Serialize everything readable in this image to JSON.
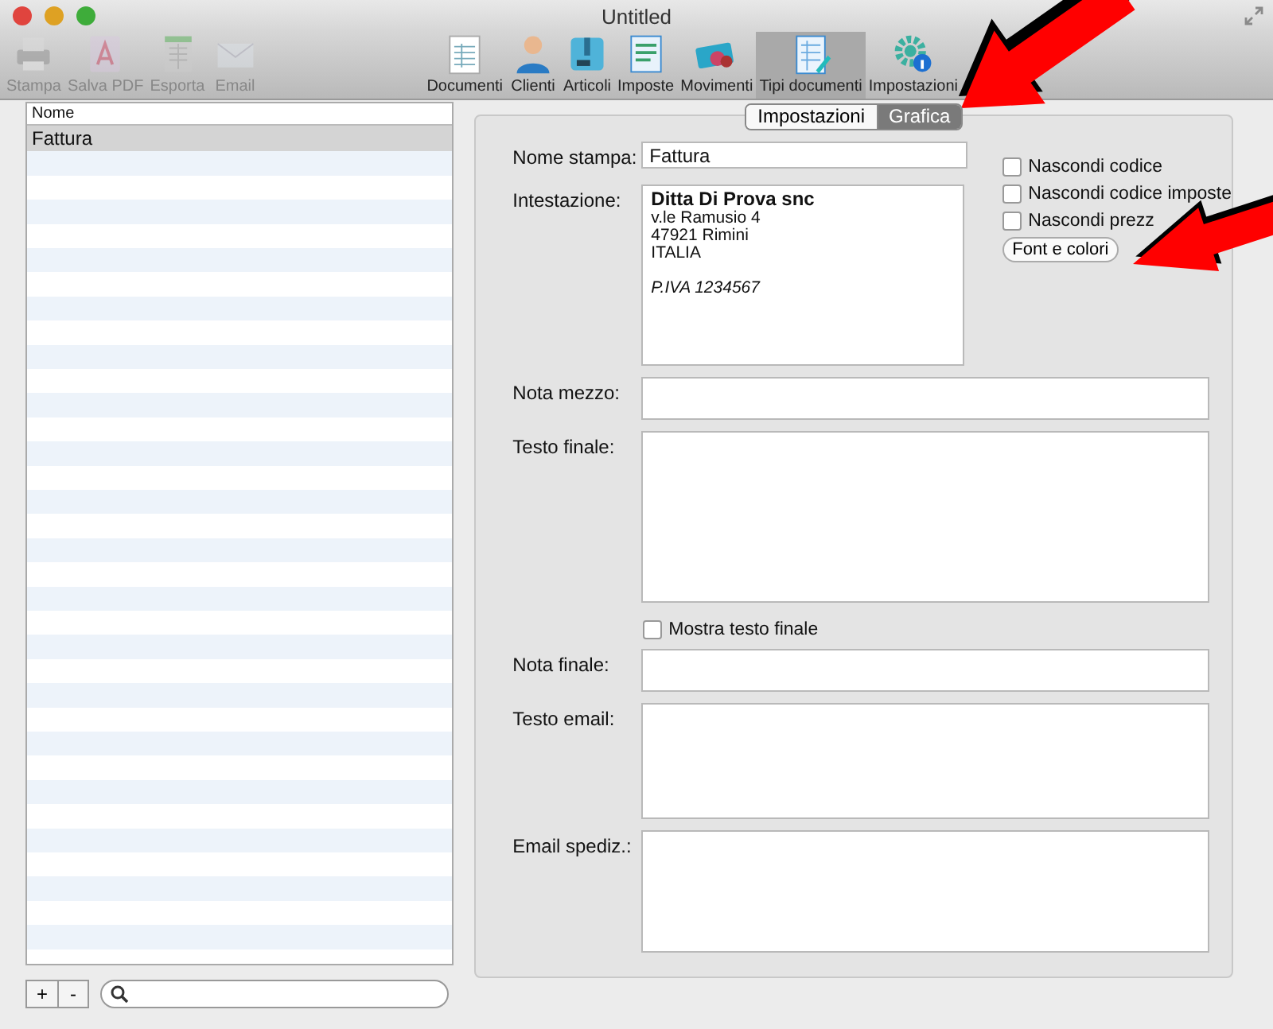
{
  "window": {
    "title": "Untitled"
  },
  "toolbar": [
    {
      "label": "Stampa",
      "disabled": true,
      "selected": false
    },
    {
      "label": "Salva PDF",
      "disabled": true,
      "selected": false
    },
    {
      "label": "Esporta",
      "disabled": true,
      "selected": false
    },
    {
      "label": "Email",
      "disabled": true,
      "selected": false
    },
    {
      "label": "Documenti",
      "disabled": false,
      "selected": false
    },
    {
      "label": "Clienti",
      "disabled": false,
      "selected": false
    },
    {
      "label": "Articoli",
      "disabled": false,
      "selected": false
    },
    {
      "label": "Imposte",
      "disabled": false,
      "selected": false
    },
    {
      "label": "Movimenti",
      "disabled": false,
      "selected": false
    },
    {
      "label": "Tipi documenti",
      "disabled": false,
      "selected": true
    },
    {
      "label": "Impostazioni",
      "disabled": false,
      "selected": false
    }
  ],
  "list": {
    "header": "Nome",
    "items": [
      {
        "label": "Fattura",
        "selected": true
      }
    ]
  },
  "tabs": [
    {
      "label": "Impostazioni",
      "selected": false
    },
    {
      "label": "Grafica",
      "selected": true
    }
  ],
  "form": {
    "nome_stampa": {
      "label": "Nome stampa:",
      "value": "Fattura"
    },
    "intestazione": {
      "label": "Intestazione:",
      "lines": [
        {
          "text": "Ditta Di Prova snc",
          "kind": "heading"
        },
        {
          "text": "v.le Ramusio 4",
          "kind": "line"
        },
        {
          "text": "47921 Rimini",
          "kind": "line"
        },
        {
          "text": "ITALIA",
          "kind": "line"
        },
        {
          "text": "P.IVA 1234567",
          "kind": "note"
        }
      ]
    },
    "options": [
      {
        "label": "Nascondi codice",
        "checked": false
      },
      {
        "label": "Nascondi codice imposte",
        "checked": false
      },
      {
        "label": "Nascondi prezz",
        "checked": false
      }
    ],
    "font_button": "Font e colori",
    "nota_mezzo": {
      "label": "Nota mezzo:"
    },
    "testo_finale": {
      "label": "Testo finale:"
    },
    "mostra": {
      "label": "Mostra testo finale",
      "checked": false
    },
    "nota_finale": {
      "label": "Nota finale:"
    },
    "testo_email": {
      "label": "Testo email:"
    },
    "email_spediz": {
      "label": "Email spediz.:"
    }
  },
  "list_buttons": [
    "+",
    "-"
  ]
}
